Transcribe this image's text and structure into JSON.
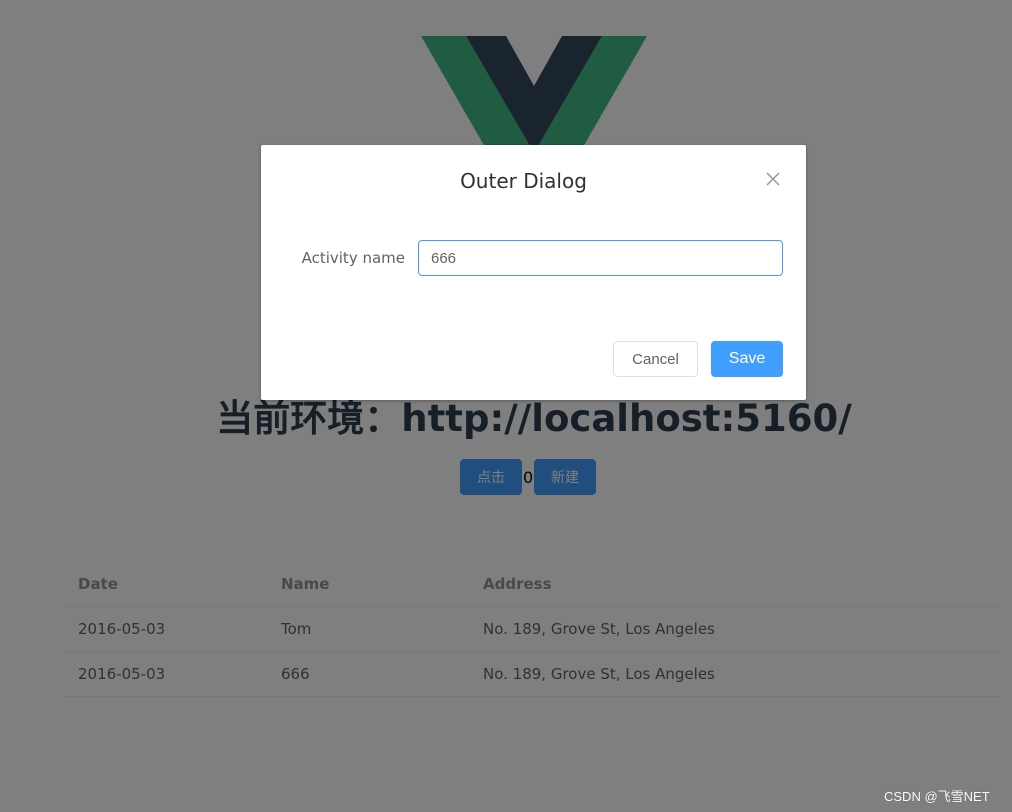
{
  "page": {
    "env_title": "当前环境：http://localhost:5160/",
    "click_button_label": "点击",
    "counter_value": "0",
    "new_button_label": "新建",
    "logo_icon": "vue-logo-icon"
  },
  "table": {
    "columns": [
      "Date",
      "Name",
      "Address"
    ],
    "rows": [
      [
        "2016-05-03",
        "Tom",
        "No. 189, Grove St, Los Angeles"
      ],
      [
        "2016-05-03",
        "666",
        "No. 189, Grove St, Los Angeles"
      ]
    ]
  },
  "dialog": {
    "title": "Outer Dialog",
    "close_icon": "close-icon",
    "field_label": "Activity name",
    "field_value": "666",
    "cancel_label": "Cancel",
    "save_label": "Save"
  },
  "watermark": "CSDN @飞雪NET",
  "colors": {
    "primary": "#409eff",
    "vue_green": "#41b883",
    "vue_dark": "#35495e",
    "mask": "rgba(0,0,0,0.5)"
  }
}
